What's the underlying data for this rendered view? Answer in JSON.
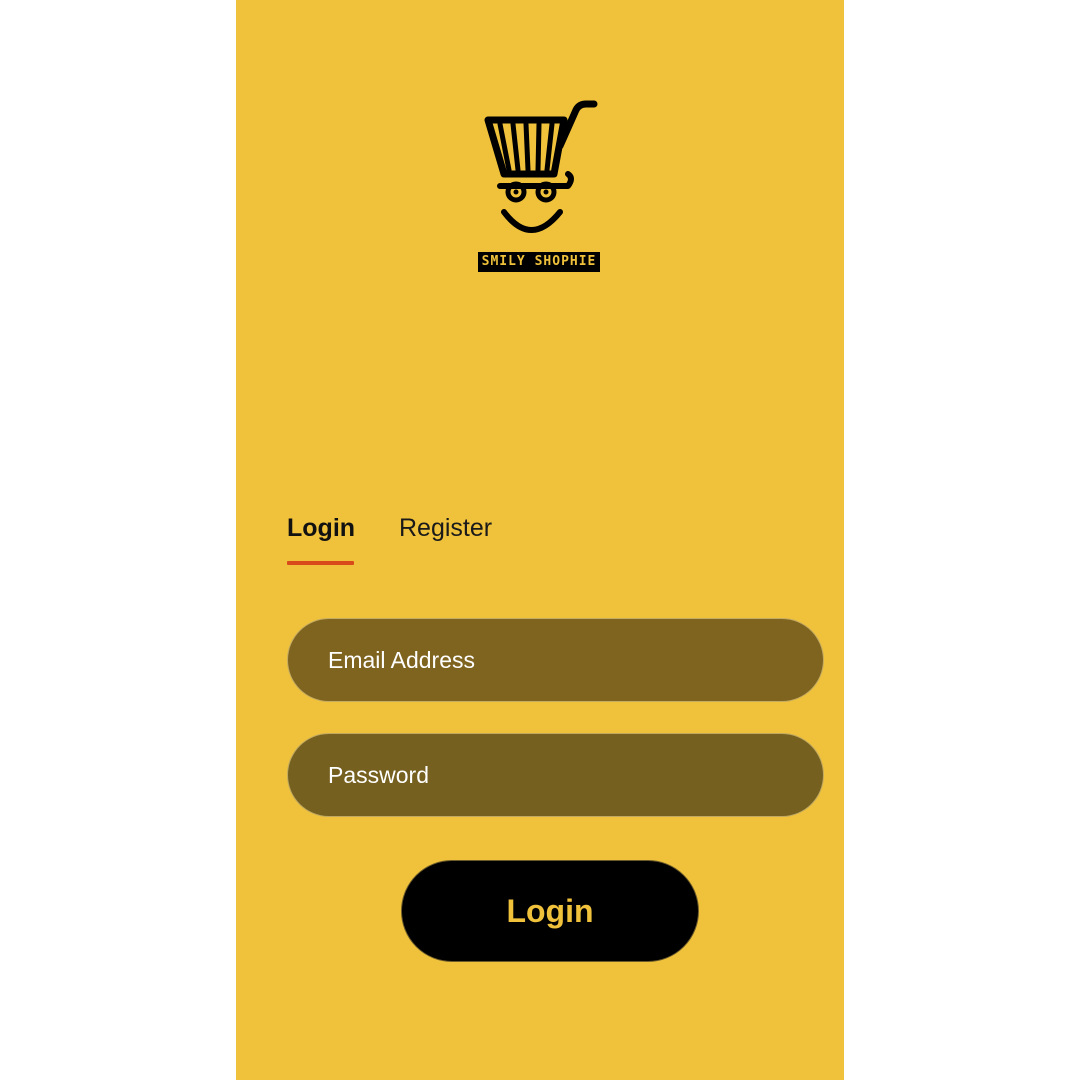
{
  "brand": {
    "name": "SMILY SHOPHIE",
    "logo_icon": "smiling-shopping-cart-icon"
  },
  "tabs": [
    {
      "label": "Login",
      "active": true
    },
    {
      "label": "Register",
      "active": false
    }
  ],
  "form": {
    "email_placeholder": "Email Address",
    "password_placeholder": "Password",
    "submit_label": "Login"
  },
  "colors": {
    "background": "#f0c23b",
    "accent_underline": "#d94a1a",
    "field_fill": "#7f6420",
    "button_fill": "#000000",
    "button_text": "#f0c23b"
  }
}
